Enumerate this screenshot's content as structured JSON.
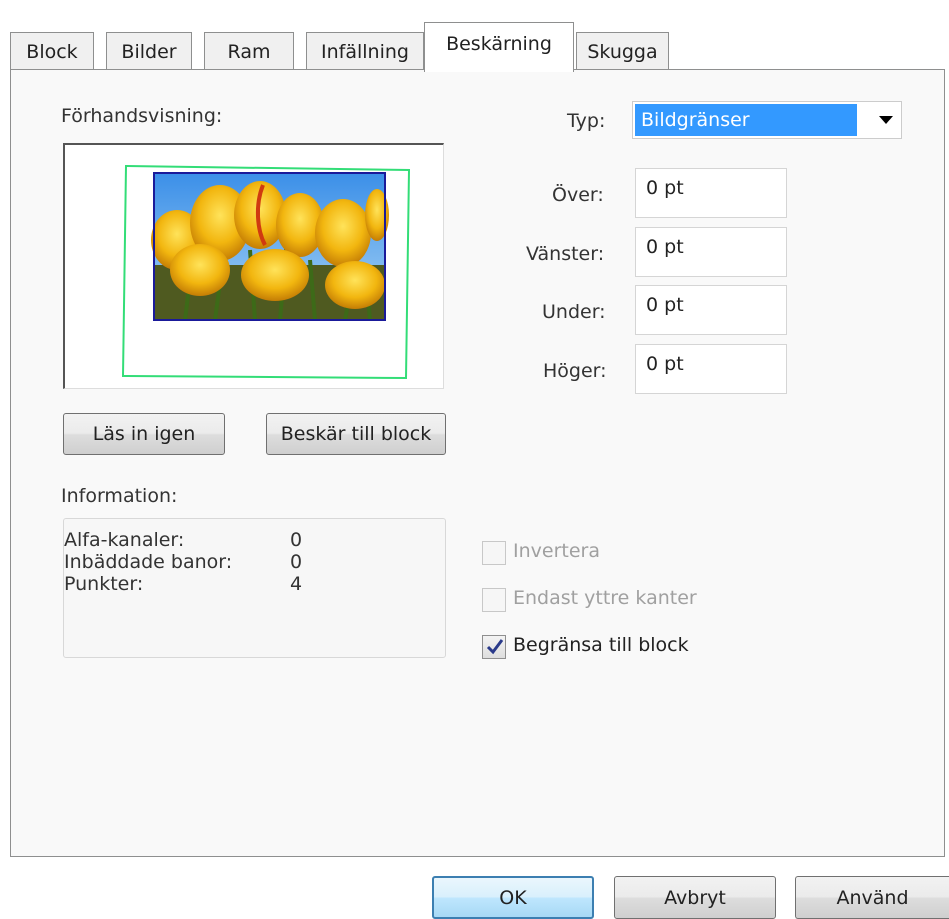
{
  "tabs": [
    {
      "label": "Block"
    },
    {
      "label": "Bilder"
    },
    {
      "label": "Ram"
    },
    {
      "label": "Infällning"
    },
    {
      "label": "Beskärning",
      "active": true
    },
    {
      "label": "Skugga"
    }
  ],
  "preview": {
    "label": "Förhandsvisning:"
  },
  "type": {
    "label": "Typ:",
    "selected": "Bildgränser"
  },
  "offsets": [
    {
      "label": "Över:",
      "value": "0 pt"
    },
    {
      "label": "Vänster:",
      "value": "0 pt"
    },
    {
      "label": "Under:",
      "value": "0 pt"
    },
    {
      "label": "Höger:",
      "value": "0 pt"
    }
  ],
  "buttons": {
    "reload": "Läs in igen",
    "crop_to_block": "Beskär till block"
  },
  "information": {
    "label": "Information:",
    "rows": [
      {
        "key": "Alfa-kanaler:",
        "value": "0"
      },
      {
        "key": "Inbäddade banor:",
        "value": "0"
      },
      {
        "key": "Punkter:",
        "value": "4"
      }
    ]
  },
  "options": [
    {
      "label": "Invertera",
      "checked": false,
      "enabled": false
    },
    {
      "label": "Endast yttre kanter",
      "checked": false,
      "enabled": false
    },
    {
      "label": "Begränsa till block",
      "checked": true,
      "enabled": true
    }
  ],
  "footer": {
    "ok": "OK",
    "cancel": "Avbryt",
    "apply": "Använd"
  },
  "colors": {
    "selection": "#3399ff",
    "crop_frame": "#33dd77",
    "image_border": "#1a1a9a"
  }
}
